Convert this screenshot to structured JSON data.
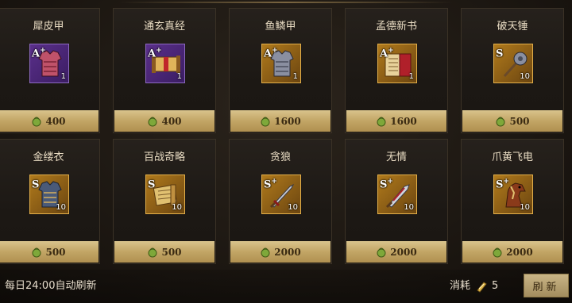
{
  "items": [
    {
      "name": "犀皮甲",
      "grade": "A",
      "plus": "+",
      "qty": "1",
      "price": "400",
      "rarity": "purple",
      "icon": "armor-icon"
    },
    {
      "name": "通玄真经",
      "grade": "A",
      "plus": "+",
      "qty": "1",
      "price": "400",
      "rarity": "purple",
      "icon": "scroll-icon"
    },
    {
      "name": "鱼鳞甲",
      "grade": "A",
      "plus": "+",
      "qty": "1",
      "price": "1600",
      "rarity": "gold",
      "icon": "armor-icon"
    },
    {
      "name": "孟德新书",
      "grade": "A",
      "plus": "+",
      "qty": "1",
      "price": "1600",
      "rarity": "gold",
      "icon": "book-icon"
    },
    {
      "name": "破天锤",
      "grade": "S",
      "plus": "",
      "qty": "10",
      "price": "500",
      "rarity": "gold",
      "icon": "hammer-icon"
    },
    {
      "name": "金缕衣",
      "grade": "S",
      "plus": "",
      "qty": "10",
      "price": "500",
      "rarity": "gold",
      "icon": "armor-icon"
    },
    {
      "name": "百战奇略",
      "grade": "S",
      "plus": "",
      "qty": "10",
      "price": "500",
      "rarity": "gold",
      "icon": "scroll-icon"
    },
    {
      "name": "贪狼",
      "grade": "S",
      "plus": "+",
      "qty": "10",
      "price": "2000",
      "rarity": "gold",
      "icon": "sword-icon"
    },
    {
      "name": "无情",
      "grade": "S",
      "plus": "+",
      "qty": "10",
      "price": "2000",
      "rarity": "gold",
      "icon": "blade-icon"
    },
    {
      "name": "爪黄飞电",
      "grade": "S",
      "plus": "+",
      "qty": "10",
      "price": "2000",
      "rarity": "gold",
      "icon": "horse-icon"
    }
  ],
  "footer": {
    "refresh_text": "每日24:00自动刷新",
    "cost_label": "消耗",
    "cost_value": "5",
    "refresh_button": "刷新"
  },
  "colors": {
    "price_bar": "#c2a565",
    "purple_slot": "#5a2f8a",
    "gold_slot": "#b07a1c"
  }
}
